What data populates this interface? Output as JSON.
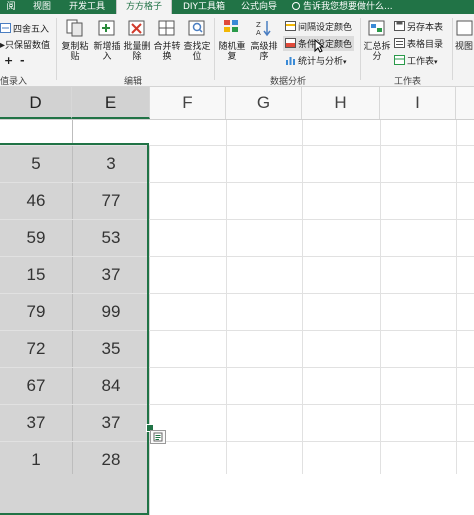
{
  "tabs": [
    {
      "label": "阅"
    },
    {
      "label": "视图"
    },
    {
      "label": "开发工具"
    },
    {
      "label": "方方格子",
      "active": true
    },
    {
      "label": "DIY工具箱"
    },
    {
      "label": "公式向导"
    },
    {
      "label": "告诉我您想要做什么..."
    }
  ],
  "ribbon": {
    "left_items": [
      "四舍五入",
      "只保留数值",
      "+",
      "-"
    ],
    "left_group_partial": "值录入",
    "edit_buttons": [
      {
        "label1": "复制粘",
        "label2": "贴",
        "icon": "copy-paste-icon"
      },
      {
        "label1": "新增插",
        "label2": "入",
        "icon": "insert-icon"
      },
      {
        "label1": "批量删",
        "label2": "除",
        "icon": "batch-delete-icon"
      },
      {
        "label1": "合并转",
        "label2": "换",
        "icon": "merge-convert-icon"
      },
      {
        "label1": "查找定",
        "label2": "位",
        "icon": "find-locate-icon"
      }
    ],
    "edit_group": "编辑",
    "analysis_buttons": [
      {
        "label1": "随机重",
        "label2": "复",
        "icon": "random-repeat-icon"
      },
      {
        "label1": "高级排",
        "label2": "序",
        "icon": "advanced-sort-icon"
      }
    ],
    "analysis_items": [
      "间隔设定颜色",
      "条件设定颜色",
      "统计与分析"
    ],
    "analysis_group": "数据分析",
    "worksheet_button": {
      "label1": "汇总拆",
      "label2": "分"
    },
    "worksheet_items": [
      "另存本表",
      "表格目录",
      "工作表"
    ],
    "worksheet_group": "工作表",
    "right_partial": "视图"
  },
  "sheet": {
    "columns": [
      "D",
      "E",
      "F",
      "G",
      "H",
      "I"
    ],
    "selected_columns": [
      "D",
      "E"
    ],
    "rows": [
      [
        "5",
        "3"
      ],
      [
        "46",
        "77"
      ],
      [
        "59",
        "53"
      ],
      [
        "15",
        "37"
      ],
      [
        "79",
        "99"
      ],
      [
        "72",
        "35"
      ],
      [
        "67",
        "84"
      ],
      [
        "37",
        "37"
      ],
      [
        "1",
        "28"
      ]
    ]
  },
  "colors": {
    "accent": "#217346",
    "selection": "#d4d4d4"
  }
}
